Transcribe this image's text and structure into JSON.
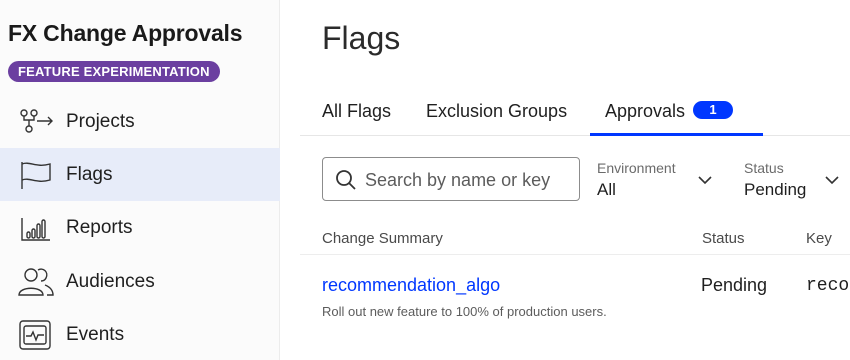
{
  "sidebar": {
    "app_title": "FX Change Approvals",
    "product_badge": "FEATURE EXPERIMENTATION",
    "items": [
      {
        "label": "Projects",
        "icon": "projects-icon",
        "active": false
      },
      {
        "label": "Flags",
        "icon": "flag-icon",
        "active": true
      },
      {
        "label": "Reports",
        "icon": "reports-icon",
        "active": false
      },
      {
        "label": "Audiences",
        "icon": "audiences-icon",
        "active": false
      },
      {
        "label": "Events",
        "icon": "events-icon",
        "active": false
      }
    ]
  },
  "main": {
    "title": "Flags",
    "tabs": [
      {
        "label": "All Flags",
        "active": false
      },
      {
        "label": "Exclusion Groups",
        "active": false
      },
      {
        "label": "Approvals",
        "active": true,
        "count": "1"
      }
    ],
    "search": {
      "placeholder": "Search by name or key",
      "value": ""
    },
    "filters": [
      {
        "label": "Environment",
        "value": "All"
      },
      {
        "label": "Status",
        "value": "Pending"
      }
    ],
    "table": {
      "columns": [
        "Change Summary",
        "Status",
        "Key"
      ],
      "rows": [
        {
          "name": "recommendation_algo",
          "description": "Roll out new feature to 100% of production users.",
          "status": "Pending",
          "key": "reco"
        }
      ]
    }
  },
  "colors": {
    "accent": "#0037ff",
    "badge": "#6b3fa0",
    "active_nav_bg": "#e7ecf9"
  }
}
